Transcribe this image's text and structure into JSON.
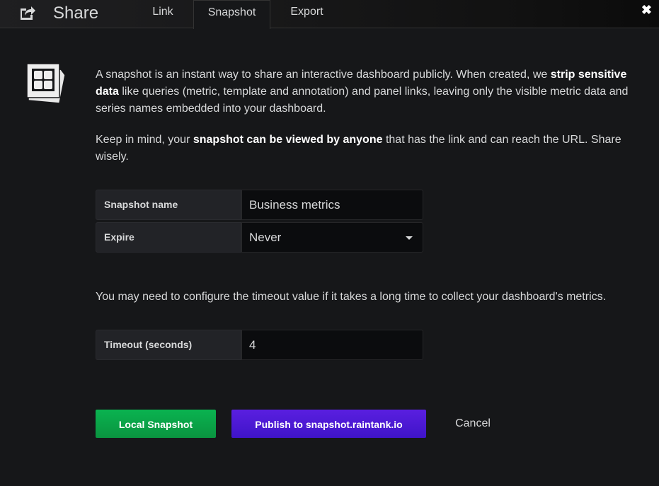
{
  "header": {
    "title": "Share",
    "tabs": [
      {
        "label": "Link"
      },
      {
        "label": "Snapshot"
      },
      {
        "label": "Export"
      }
    ],
    "close": "✖"
  },
  "intro": {
    "p1_a": "A snapshot is an instant way to share an interactive dashboard publicly. When created, we ",
    "p1_b": "strip sensitive data",
    "p1_c": " like queries (metric, template and annotation) and panel links, leaving only the visible metric data and series names embedded into your dashboard.",
    "p2_a": "Keep in mind, your ",
    "p2_b": "snapshot can be viewed by anyone",
    "p2_c": " that has the link and can reach the URL. Share wisely."
  },
  "form": {
    "name_label": "Snapshot name",
    "name_value": "Business metrics",
    "expire_label": "Expire",
    "expire_value": "Never",
    "timeout_note": "You may need to configure the timeout value if it takes a long time to collect your dashboard's metrics.",
    "timeout_label": "Timeout (seconds)",
    "timeout_value": "4"
  },
  "buttons": {
    "local": "Local Snapshot",
    "publish": "Publish to snapshot.raintank.io",
    "cancel": "Cancel"
  },
  "colors": {
    "local": "#0aa147",
    "publish": "#4c18d8"
  }
}
